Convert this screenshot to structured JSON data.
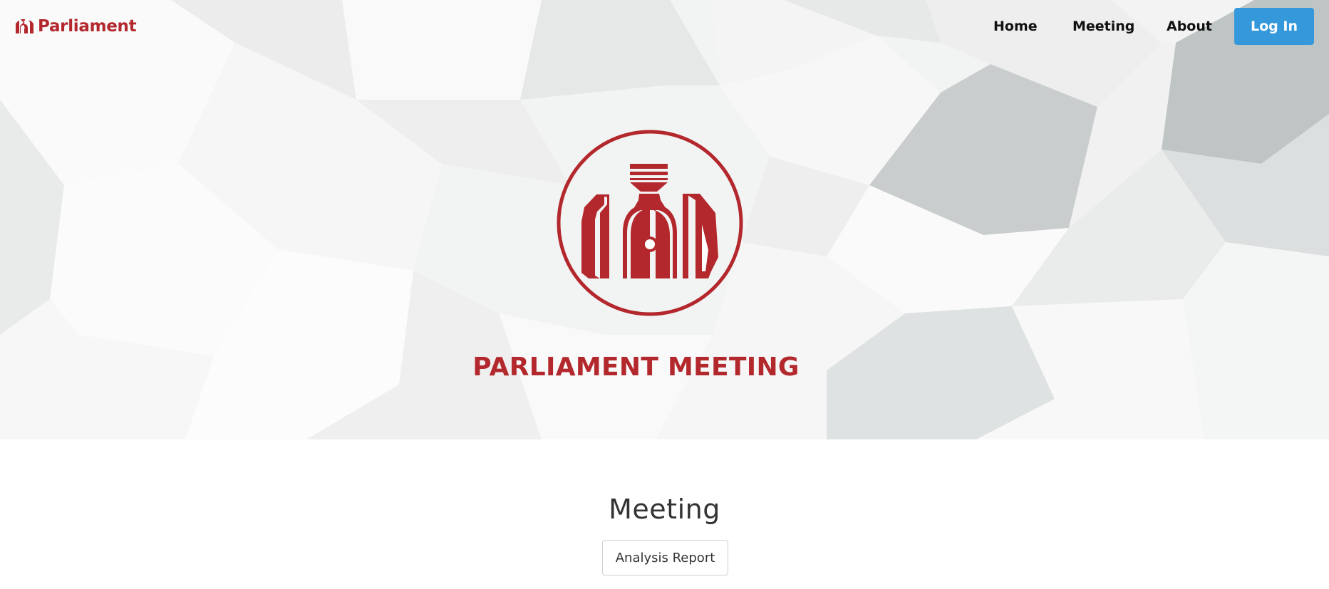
{
  "brand": {
    "name": "Parliament",
    "logo_icon": "parliament-building-icon",
    "color": "#b3282d"
  },
  "nav": {
    "items": [
      {
        "label": "Home"
      },
      {
        "label": "Meeting"
      },
      {
        "label": "About"
      }
    ],
    "login_label": "Log In",
    "login_color": "#3498db"
  },
  "hero": {
    "emblem_icon": "parliament-emblem-icon",
    "title": "PARLIAMENT MEETING"
  },
  "section": {
    "title": "Meeting",
    "button_label": "Analysis Report"
  }
}
